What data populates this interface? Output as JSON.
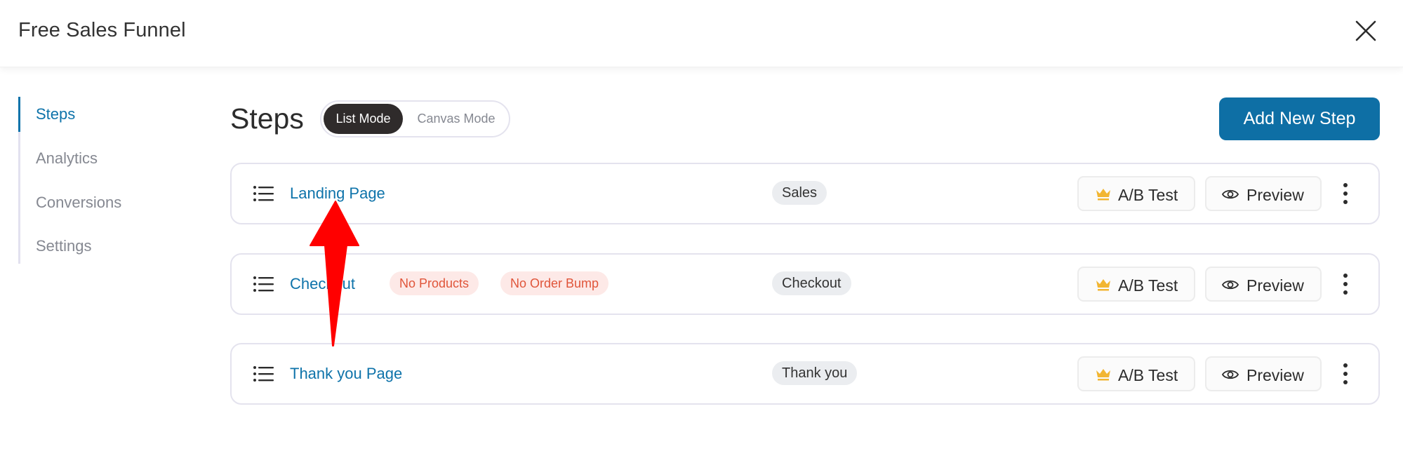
{
  "header": {
    "title": "Free Sales Funnel",
    "close_icon": "close-icon"
  },
  "sidebar": {
    "items": [
      {
        "label": "Steps",
        "active": true
      },
      {
        "label": "Analytics",
        "active": false
      },
      {
        "label": "Conversions",
        "active": false
      },
      {
        "label": "Settings",
        "active": false
      }
    ]
  },
  "main": {
    "title": "Steps",
    "mode_toggle": {
      "options": [
        "List Mode",
        "Canvas Mode"
      ],
      "selected": "List Mode"
    },
    "add_step_label": "Add New Step",
    "steps": [
      {
        "name": "Landing Page",
        "warnings": [],
        "type": "Sales",
        "ab_label": "A/B Test",
        "preview_label": "Preview"
      },
      {
        "name": "Checkout",
        "warnings": [
          "No Products",
          "No Order Bump"
        ],
        "type": "Checkout",
        "ab_label": "A/B Test",
        "preview_label": "Preview"
      },
      {
        "name": "Thank you Page",
        "warnings": [],
        "type": "Thank you",
        "ab_label": "A/B Test",
        "preview_label": "Preview"
      }
    ]
  },
  "colors": {
    "accent": "#0e73aa",
    "primary_button": "#0e6fa5",
    "toggle_active": "#2f2b2b",
    "warning_text": "#e0553a",
    "warning_bg": "#fde9e7",
    "badge_bg": "#ebedf0",
    "crown": "#f2b632",
    "annotation_arrow": "#ff0000"
  },
  "annotation": {
    "type": "arrow",
    "direction": "up",
    "points_to": "Landing Page"
  }
}
